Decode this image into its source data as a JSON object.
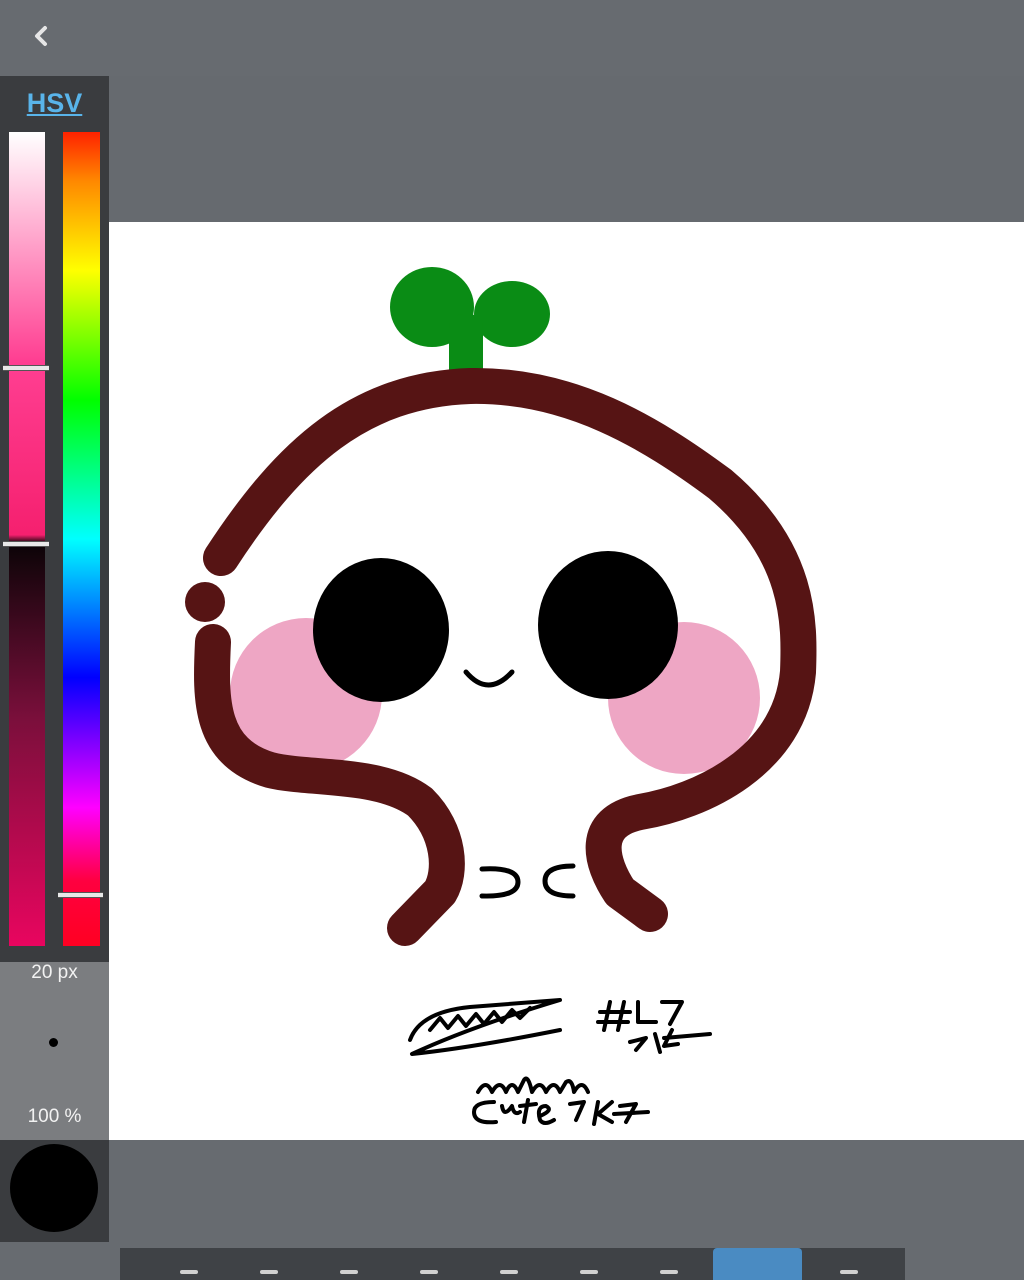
{
  "toolbar_top": {
    "back_icon": "chevron-left-icon"
  },
  "color_panel": {
    "mode_label": "HSV",
    "brush_size": "20 px",
    "opacity": "100 %",
    "current_color": "#000000",
    "saturation_value_level": 0.29,
    "hue_level": 0.94
  },
  "bottom_toolbar": {
    "tools": [
      "brush-icon",
      "eraser-icon",
      "fill-icon",
      "grid-icon",
      "undo-icon",
      "redo-icon",
      "layers-icon",
      "active-tool",
      "more-icon"
    ],
    "active_index": 7
  },
  "drawing": {
    "colors": {
      "outline": "#561414",
      "sprout": "#0a8c15",
      "eyes": "#000000",
      "blush": "#eea6c4"
    }
  }
}
